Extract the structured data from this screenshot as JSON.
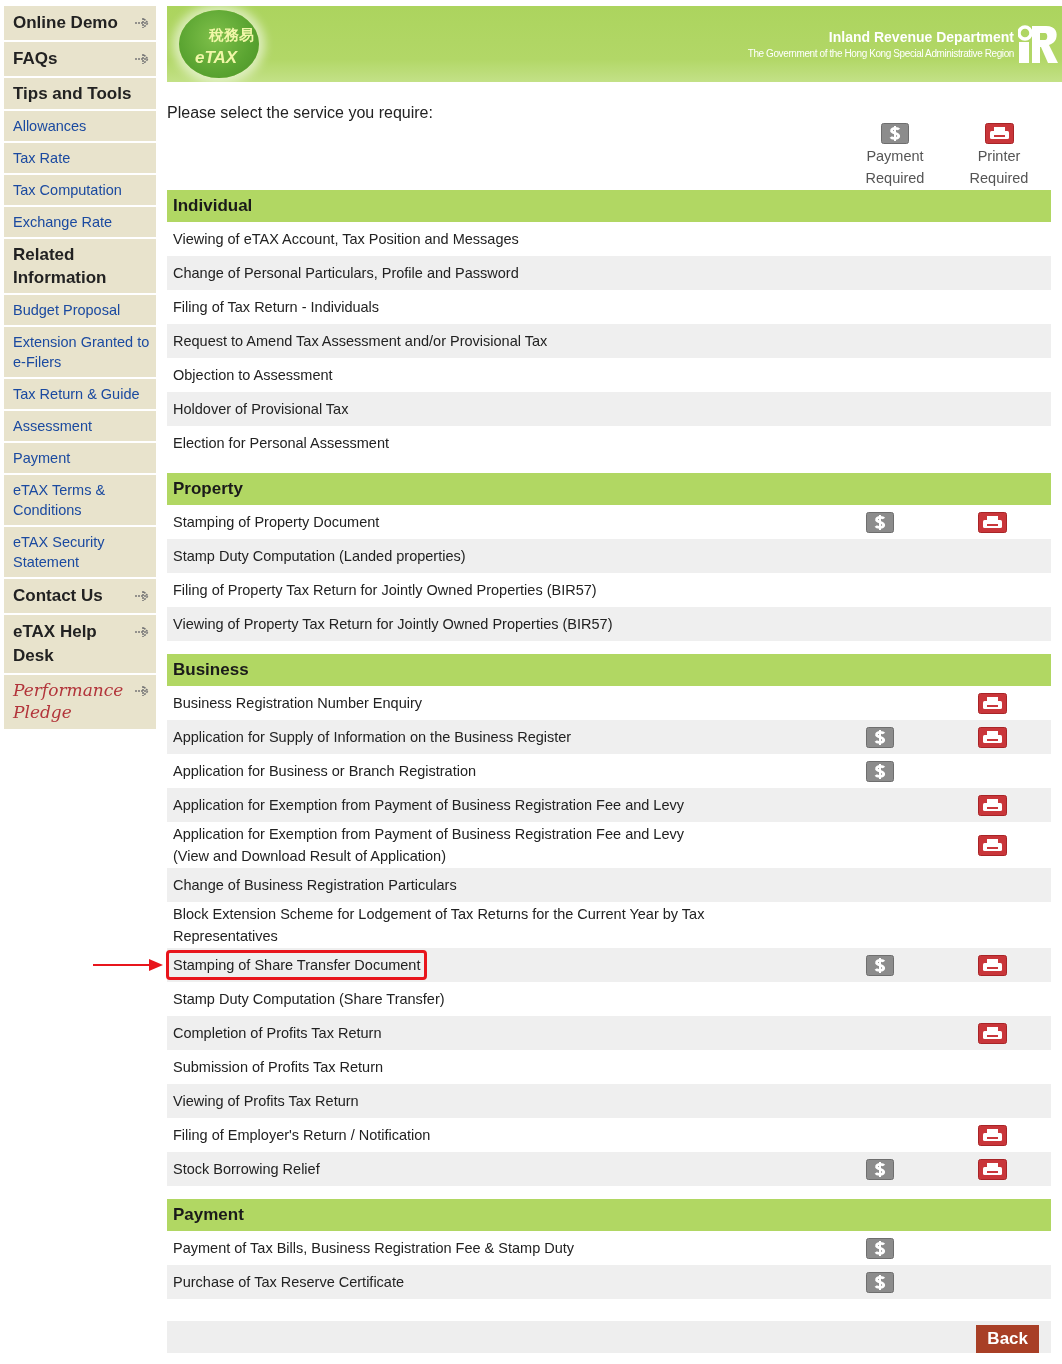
{
  "sidebar": {
    "items": [
      {
        "label": "Online Demo",
        "kind": "menu"
      },
      {
        "label": "FAQs",
        "kind": "menu"
      },
      {
        "label": "Tips and Tools",
        "kind": "heading"
      },
      {
        "label": "Allowances",
        "kind": "link"
      },
      {
        "label": "Tax Rate",
        "kind": "link"
      },
      {
        "label": "Tax Computation",
        "kind": "link"
      },
      {
        "label": "Exchange Rate",
        "kind": "link"
      },
      {
        "label": "Related Information",
        "kind": "heading"
      },
      {
        "label": "Budget Proposal",
        "kind": "link"
      },
      {
        "label": "Extension Granted to e-Filers",
        "kind": "link"
      },
      {
        "label": "Tax Return & Guide",
        "kind": "link"
      },
      {
        "label": "Assessment",
        "kind": "link"
      },
      {
        "label": "Payment",
        "kind": "link"
      },
      {
        "label": "eTAX Terms & Conditions",
        "kind": "link"
      },
      {
        "label": "eTAX Security Statement",
        "kind": "link"
      },
      {
        "label": "Contact Us",
        "kind": "menu"
      },
      {
        "label": "eTAX Help Desk",
        "kind": "menu"
      },
      {
        "label": "Performance Pledge",
        "kind": "pledge"
      }
    ]
  },
  "header": {
    "logo_chinese": "稅務易",
    "logo_latin": "eTAX",
    "department": "Inland Revenue Department",
    "government": "The Government of the Hong Kong Special Administrative Region"
  },
  "prompt": "Please select the service you require:",
  "legend": {
    "payment": "Payment Required",
    "printer": "Printer Required"
  },
  "sections": [
    {
      "title": "Individual",
      "rows": [
        {
          "label": "Viewing of eTAX Account, Tax Position and Messages",
          "payment": false,
          "printer": false,
          "highlighted": false
        },
        {
          "label": "Change of Personal Particulars, Profile and Password",
          "payment": false,
          "printer": false,
          "highlighted": false
        },
        {
          "label": "Filing of Tax Return - Individuals",
          "payment": false,
          "printer": false,
          "highlighted": false
        },
        {
          "label": "Request to Amend Tax Assessment and/or Provisional Tax",
          "payment": false,
          "printer": false,
          "highlighted": false
        },
        {
          "label": "Objection to Assessment",
          "payment": false,
          "printer": false,
          "highlighted": false
        },
        {
          "label": "Holdover of Provisional Tax",
          "payment": false,
          "printer": false,
          "highlighted": false
        },
        {
          "label": "Election for Personal Assessment",
          "payment": false,
          "printer": false,
          "highlighted": false
        }
      ]
    },
    {
      "title": "Property",
      "rows": [
        {
          "label": "Stamping of Property Document",
          "payment": true,
          "printer": true,
          "highlighted": false
        },
        {
          "label": "Stamp Duty Computation (Landed properties)",
          "payment": false,
          "printer": false,
          "highlighted": false
        },
        {
          "label": "Filing of Property Tax Return for Jointly Owned Properties (BIR57)",
          "payment": false,
          "printer": false,
          "highlighted": false
        },
        {
          "label": "Viewing of Property Tax Return for Jointly Owned Properties (BIR57)",
          "payment": false,
          "printer": false,
          "highlighted": false
        }
      ]
    },
    {
      "title": "Business",
      "rows": [
        {
          "label": "Business Registration Number Enquiry",
          "payment": false,
          "printer": true,
          "highlighted": false
        },
        {
          "label": "Application for Supply of Information on the Business Register",
          "payment": true,
          "printer": true,
          "highlighted": false
        },
        {
          "label": "Application for Business or Branch Registration",
          "payment": true,
          "printer": false,
          "highlighted": false
        },
        {
          "label": "Application for Exemption from Payment of Business Registration Fee and Levy",
          "payment": false,
          "printer": true,
          "highlighted": false
        },
        {
          "label": "Application for Exemption from Payment of Business Registration Fee and Levy (View and Download Result of Application)",
          "payment": false,
          "printer": true,
          "highlighted": false
        },
        {
          "label": "Change of Business Registration Particulars",
          "payment": false,
          "printer": false,
          "highlighted": false
        },
        {
          "label": "Block Extension Scheme for Lodgement of Tax Returns for the Current Year by Tax Representatives",
          "payment": false,
          "printer": false,
          "highlighted": false
        },
        {
          "label": "Stamping of Share Transfer Document",
          "payment": true,
          "printer": true,
          "highlighted": true
        },
        {
          "label": "Stamp Duty Computation (Share Transfer)",
          "payment": false,
          "printer": false,
          "highlighted": false
        },
        {
          "label": "Completion of Profits Tax Return",
          "payment": false,
          "printer": true,
          "highlighted": false
        },
        {
          "label": "Submission of Profits Tax Return",
          "payment": false,
          "printer": false,
          "highlighted": false
        },
        {
          "label": "Viewing of Profits Tax Return",
          "payment": false,
          "printer": false,
          "highlighted": false
        },
        {
          "label": "Filing of Employer's Return / Notification",
          "payment": false,
          "printer": true,
          "highlighted": false
        },
        {
          "label": "Stock Borrowing Relief",
          "payment": true,
          "printer": true,
          "highlighted": false
        }
      ]
    },
    {
      "title": "Payment",
      "rows": [
        {
          "label": "Payment of Tax Bills, Business Registration Fee & Stamp Duty",
          "payment": true,
          "printer": false,
          "highlighted": false
        },
        {
          "label": "Purchase of Tax Reserve Certificate",
          "payment": true,
          "printer": false,
          "highlighted": false
        }
      ]
    }
  ],
  "back_button": "Back"
}
